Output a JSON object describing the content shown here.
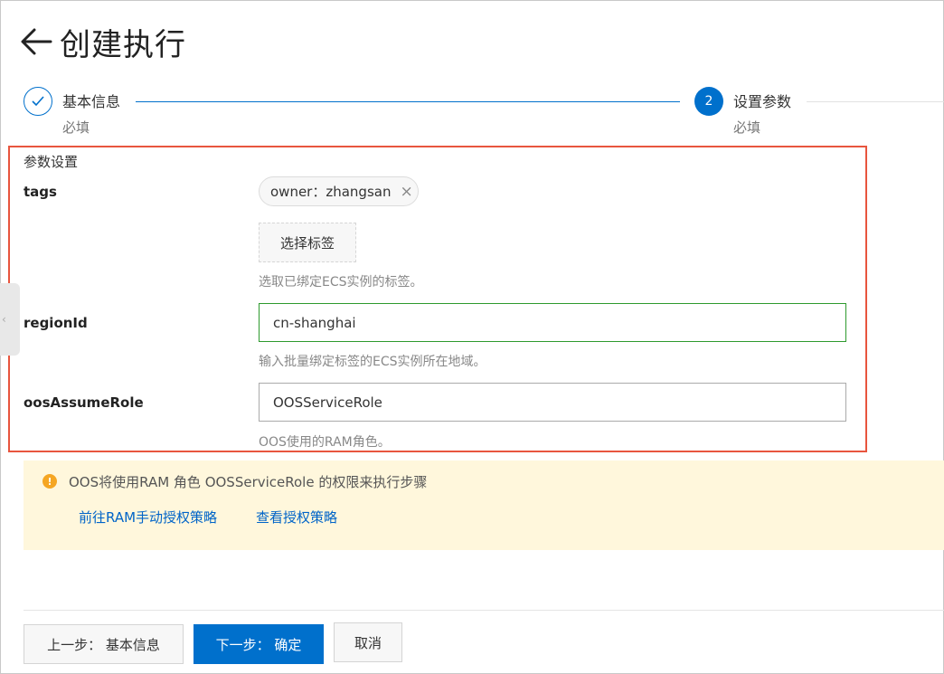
{
  "header": {
    "title": "创建执行"
  },
  "steps": [
    {
      "number": "",
      "title": "基本信息",
      "desc": "必填",
      "status": "done"
    },
    {
      "number": "2",
      "title": "设置参数",
      "desc": "必填",
      "status": "active"
    }
  ],
  "params": {
    "section_title": "参数设置",
    "tags": {
      "label": "tags",
      "chip": "owner：zhangsan",
      "chip_close": "×",
      "select_button": "选择标签",
      "help": "选取已绑定ECS实例的标签。"
    },
    "region": {
      "label": "regionId",
      "value": "cn-shanghai",
      "help": "输入批量绑定标签的ECS实例所在地域。"
    },
    "role": {
      "label": "oosAssumeRole",
      "value": "OOSServiceRole",
      "help": "OOS使用的RAM角色。"
    }
  },
  "notice": {
    "icon": "!",
    "text": "OOS将使用RAM 角色 OOSServiceRole 的权限来执行步骤",
    "link_manual": "前往RAM手动授权策略",
    "link_view": "查看授权策略"
  },
  "footer": {
    "prev": "上一步： 基本信息",
    "next": "下一步： 确定",
    "cancel": "取消"
  },
  "colors": {
    "primary": "#0070cc",
    "highlight_border": "#e8553e",
    "valid_border": "#2e9a2e",
    "notice_bg": "#fff7dc",
    "warning": "#f5a623"
  }
}
